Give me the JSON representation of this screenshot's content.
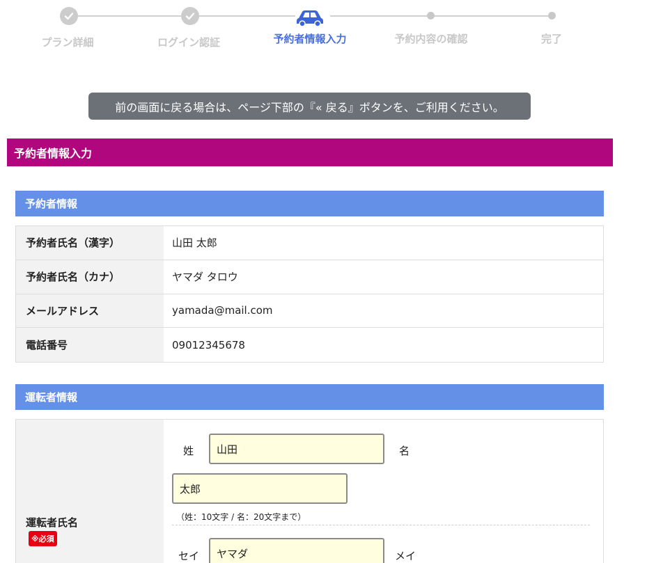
{
  "stepper": {
    "steps": [
      {
        "label": "プラン詳細",
        "state": "done"
      },
      {
        "label": "ログイン認証",
        "state": "done"
      },
      {
        "label": "予約者情報入力",
        "state": "active"
      },
      {
        "label": "予約内容の確認",
        "state": "pending"
      },
      {
        "label": "完了",
        "state": "pending"
      }
    ],
    "active_color": "#4a6fd8",
    "inactive_color": "#c8c8c8"
  },
  "notice": "前の画面に戻る場合は、ページ下部の『« 戻る』ボタンを、ご利用ください。",
  "section_title": "予約者情報入力",
  "booker": {
    "heading": "予約者情報",
    "rows": [
      {
        "label": "予約者氏名（漢字）",
        "value": "山田 太郎"
      },
      {
        "label": "予約者氏名（カナ）",
        "value": "ヤマダ タロウ"
      },
      {
        "label": "メールアドレス",
        "value": "yamada@mail.com"
      },
      {
        "label": "電話番号",
        "value": "09012345678"
      }
    ]
  },
  "driver": {
    "heading": "運転者情報",
    "name_label": "運転者氏名",
    "required_badge": "※必須",
    "last_name_label": "姓",
    "first_name_label": "名",
    "last_name_value": "山田",
    "first_name_value": "太郎",
    "kanji_hint": "（姓：10文字 / 名：20文字まで）",
    "last_kana_label": "セイ",
    "first_kana_label": "メイ",
    "last_kana_value": "ヤマダ"
  },
  "colors": {
    "banner": "#b0077e",
    "subhead": "#6590e8",
    "notice_bg": "#6b7177",
    "input_bg": "#ffffe0",
    "required": "#e60012"
  }
}
